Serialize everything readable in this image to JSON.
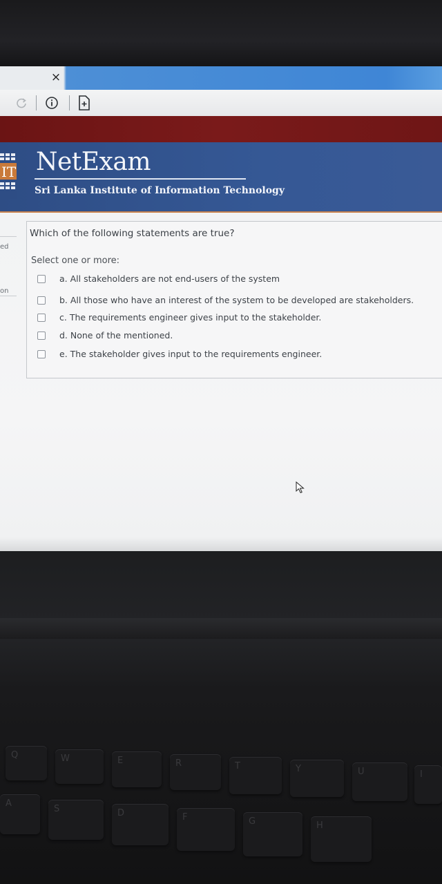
{
  "browser": {
    "tab_close_glyph": "×",
    "icons": [
      "reload-icon",
      "info-icon",
      "page-icon"
    ]
  },
  "header": {
    "logo_text": "IT",
    "brand_title": "NetExam",
    "brand_subtitle": "Sri Lanka Institute of Information Technology"
  },
  "sidebar_fragments": {
    "fragment_1": "ed",
    "fragment_2": "on"
  },
  "question": {
    "text": "Which of the following statements are true?",
    "prompt": "Select one or more:",
    "options": [
      {
        "label": "a. All stakeholders are not end-users of the system",
        "checked": false
      },
      {
        "label": "b. All those who have an interest of the system to be developed are stakeholders.",
        "checked": false
      },
      {
        "label": "c. The requirements engineer gives input to the stakeholder.",
        "checked": false
      },
      {
        "label": "d. None of the mentioned.",
        "checked": false
      },
      {
        "label": "e. The stakeholder gives input to the requirements engineer.",
        "checked": false
      }
    ]
  },
  "keyboard": {
    "keys": [
      "Q",
      "W",
      "E",
      "R",
      "T",
      "Y",
      "U",
      "I",
      "A",
      "S",
      "D",
      "F",
      "G",
      "H"
    ]
  },
  "colors": {
    "header_blue": "#355895",
    "maroon_bar": "#7a1a1a",
    "tab_blue": "#3f86d6"
  }
}
